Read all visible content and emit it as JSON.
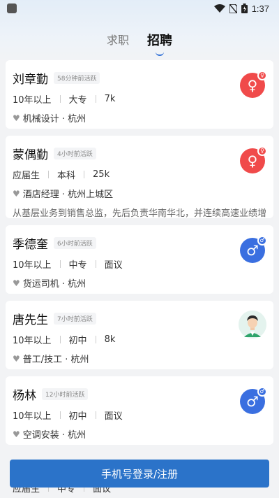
{
  "status": {
    "time": "1:37"
  },
  "tabs": [
    {
      "label": "求职",
      "active": false
    },
    {
      "label": "招聘",
      "active": true
    }
  ],
  "candidates": [
    {
      "name": "刘章勤",
      "active": "58分钟前活跃",
      "exp": "10年以上",
      "edu": "大专",
      "salary": "7k",
      "job": "机械设计 · 杭州",
      "desc": "",
      "gender": "female"
    },
    {
      "name": "蒙偶勤",
      "active": "4小时前活跃",
      "exp": "应届生",
      "edu": "本科",
      "salary": "25k",
      "job": "酒店经理 · 杭州上城区",
      "desc": "从基层业务到销售总监，先后负责华南华北，并连续高速业绩增长",
      "gender": "female"
    },
    {
      "name": "季德奎",
      "active": "6小时前活跃",
      "exp": "10年以上",
      "edu": "中专",
      "salary": "面议",
      "job": "货运司机 · 杭州",
      "desc": "",
      "gender": "male"
    },
    {
      "name": "唐先生",
      "active": "7小时前活跃",
      "exp": "10年以上",
      "edu": "初中",
      "salary": "8k",
      "job": "普工/技工 · 杭州",
      "desc": "",
      "gender": "photo"
    },
    {
      "name": "杨林",
      "active": "12小时前活跃",
      "exp": "10年以上",
      "edu": "初中",
      "salary": "面议",
      "job": "空调安装 · 杭州",
      "desc": "",
      "gender": "male"
    }
  ],
  "partial_row": {
    "exp": "应届生",
    "edu": "中专",
    "salary": "面议"
  },
  "login_button": "手机号登录/注册",
  "colors": {
    "accent": "#2b73c9",
    "female": "#f04a4a",
    "male": "#3a6fe0"
  }
}
